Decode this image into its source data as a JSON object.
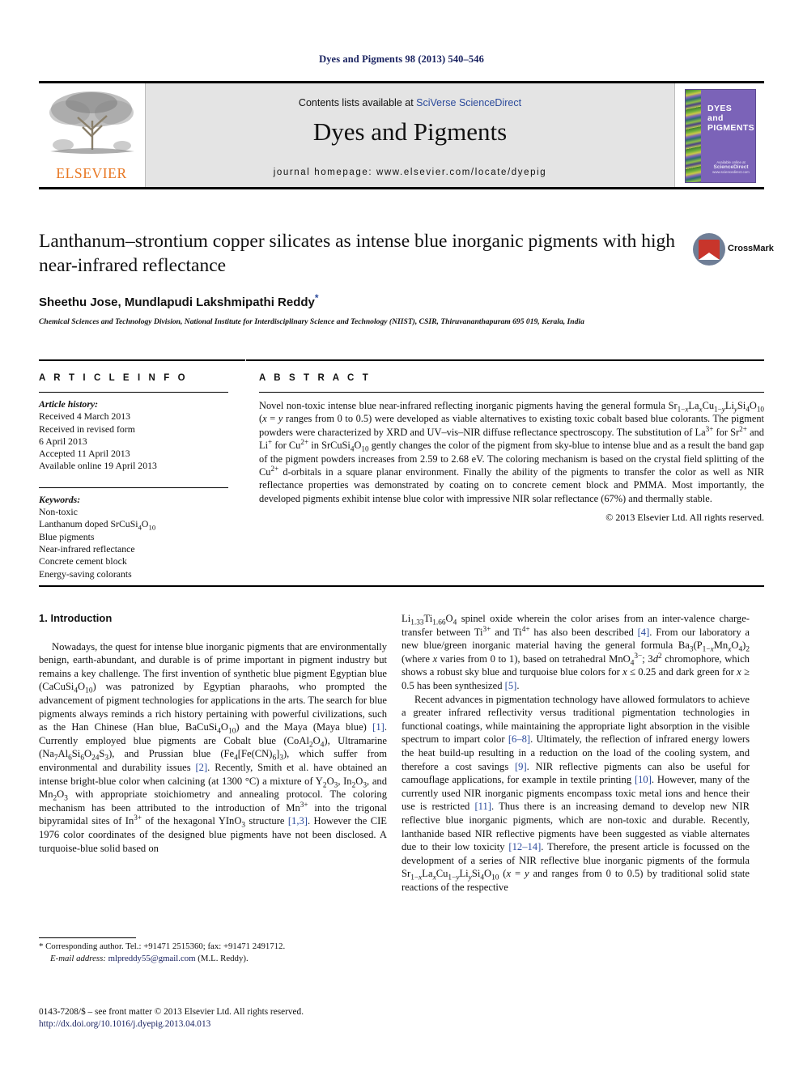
{
  "running_head": "Dyes and Pigments 98 (2013) 540–546",
  "masthead": {
    "publisher_name": "ELSEVIER",
    "contents_prefix": "Contents lists available at ",
    "contents_link": "SciVerse ScienceDirect",
    "journal_title": "Dyes and Pigments",
    "homepage": "journal homepage: www.elsevier.com/locate/dyepig",
    "cover": {
      "line1": "DYES",
      "line2": "and",
      "line3": "PIGMENTS",
      "foot_small": "Available online at",
      "foot_big": "ScienceDirect",
      "foot_tiny": "www.sciencedirect.com"
    }
  },
  "article": {
    "title": "Lanthanum–strontium copper silicates as intense blue inorganic pigments with high near-infrared reflectance",
    "authors": "Sheethu Jose, Mundlapudi Lakshmipathi Reddy",
    "corresponding_marker": "*",
    "affiliation": "Chemical Sciences and Technology Division, National Institute for Interdisciplinary Science and Technology (NIIST), CSIR, Thiruvananthapuram 695 019, Kerala, India",
    "crossmark_label": "CrossMark"
  },
  "article_info": {
    "heading": "A R T I C L E   I N F O",
    "history_label": "Article history:",
    "history": [
      "Received 4 March 2013",
      "Received in revised form",
      "6 April 2013",
      "Accepted 11 April 2013",
      "Available online 19 April 2013"
    ],
    "keywords_label": "Keywords:",
    "keywords": [
      "Non-toxic",
      "Lanthanum doped SrCuSi4O10",
      "Blue pigments",
      "Near-infrared reflectance",
      "Concrete cement block",
      "Energy-saving colorants"
    ]
  },
  "abstract": {
    "heading": "A B S T R A C T",
    "text_p1": "Novel non-toxic intense blue near-infrared reflecting inorganic pigments having the general formula Sr1−xLaxCu1−yLiySi4O10 (x = y ranges from 0 to 0.5) were developed as viable alternatives to existing toxic cobalt based blue colorants. The pigment powders were characterized by XRD and UV–vis–NIR diffuse reflectance spectroscopy. The substitution of La3+ for Sr2+ and Li+ for Cu2+ in SrCuSi4O10 gently changes the color of the pigment from sky-blue to intense blue and as a result the band gap of the pigment powders increases from 2.59 to 2.68 eV. The coloring mechanism is based on the crystal field splitting of the Cu2+ d-orbitals in a square planar environment. Finally the ability of the pigments to transfer the color as well as NIR reflectance properties was demonstrated by coating on to concrete cement block and PMMA. Most importantly, the developed pigments exhibit intense blue color with impressive NIR solar reflectance (67%) and thermally stable.",
    "copyright": "© 2013 Elsevier Ltd. All rights reserved."
  },
  "introduction": {
    "heading": "1. Introduction",
    "left_p1": "Nowadays, the quest for intense blue inorganic pigments that are environmentally benign, earth-abundant, and durable is of prime important in pigment industry but remains a key challenge. The first invention of synthetic blue pigment Egyptian blue (CaCuSi4O10) was patronized by Egyptian pharaohs, who prompted the advancement of pigment technologies for applications in the arts. The search for blue pigments always reminds a rich history pertaining with powerful civilizations, such as the Han Chinese (Han blue, BaCuSi4O10) and the Maya (Maya blue) [1]. Currently employed blue pigments are Cobalt blue (CoAl2O4), Ultramarine (Na7Al6Si6O24S3), and Prussian blue (Fe4[Fe(CN)6]3), which suffer from environmental and durability issues [2]. Recently, Smith et al. have obtained an intense bright-blue color when calcining (at 1300 °C) a mixture of Y2O3, In2O3, and Mn2O3 with appropriate stoichiometry and annealing protocol. The coloring mechanism has been attributed to the introduction of Mn3+ into the trigonal bipyramidal sites of In3+ of the hexagonal YInO3 structure [1,3]. However the CIE 1976 color coordinates of the designed blue pigments have not been disclosed. A turquoise-blue solid based on",
    "right_p1": "Li1.33Ti1.66O4 spinel oxide wherein the color arises from an inter-valence charge-transfer between Ti3+ and Ti4+ has also been described [4]. From our laboratory a new blue/green inorganic material having the general formula Ba3(P1−xMnxO4)2 (where x varies from 0 to 1), based on tetrahedral MnO4 3−; 3d2 chromophore, which shows a robust sky blue and turquoise blue colors for x ≤ 0.25 and dark green for x ≥ 0.5 has been synthesized [5].",
    "right_p2": "Recent advances in pigmentation technology have allowed formulators to achieve a greater infrared reflectivity versus traditional pigmentation technologies in functional coatings, while maintaining the appropriate light absorption in the visible spectrum to impart color [6–8]. Ultimately, the reflection of infrared energy lowers the heat build-up resulting in a reduction on the load of the cooling system, and therefore a cost savings [9]. NIR reflective pigments can also be useful for camouflage applications, for example in textile printing [10]. However, many of the currently used NIR inorganic pigments encompass toxic metal ions and hence their use is restricted [11]. Thus there is an increasing demand to develop new NIR reflective blue inorganic pigments, which are non-toxic and durable. Recently, lanthanide based NIR reflective pigments have been suggested as viable alternates due to their low toxicity [12–14]. Therefore, the present article is focussed on the development of a series of NIR reflective blue inorganic pigments of the formula Sr1−xLaxCu1−yLiySi4O10 (x = y and ranges from 0 to 0.5) by traditional solid state reactions of the respective"
  },
  "footnote": {
    "corresponding": "* Corresponding author. Tel.: +91471 2515360; fax: +91471 2491712.",
    "email_label": "E-mail address:",
    "email": "mlpreddy55@gmail.com",
    "email_suffix": "(M.L. Reddy)."
  },
  "imprint": {
    "issn_line": "0143-7208/$ – see front matter © 2013 Elsevier Ltd. All rights reserved.",
    "doi": "http://dx.doi.org/10.1016/j.dyepig.2013.04.013"
  },
  "colors": {
    "link_blue": "#2b4a9b",
    "header_navy": "#17205e",
    "elsevier_orange": "#e87722",
    "masthead_grey": "#e4e4e4",
    "cover_purple": "#7b63b8",
    "crossmark_red": "#c8352b"
  }
}
